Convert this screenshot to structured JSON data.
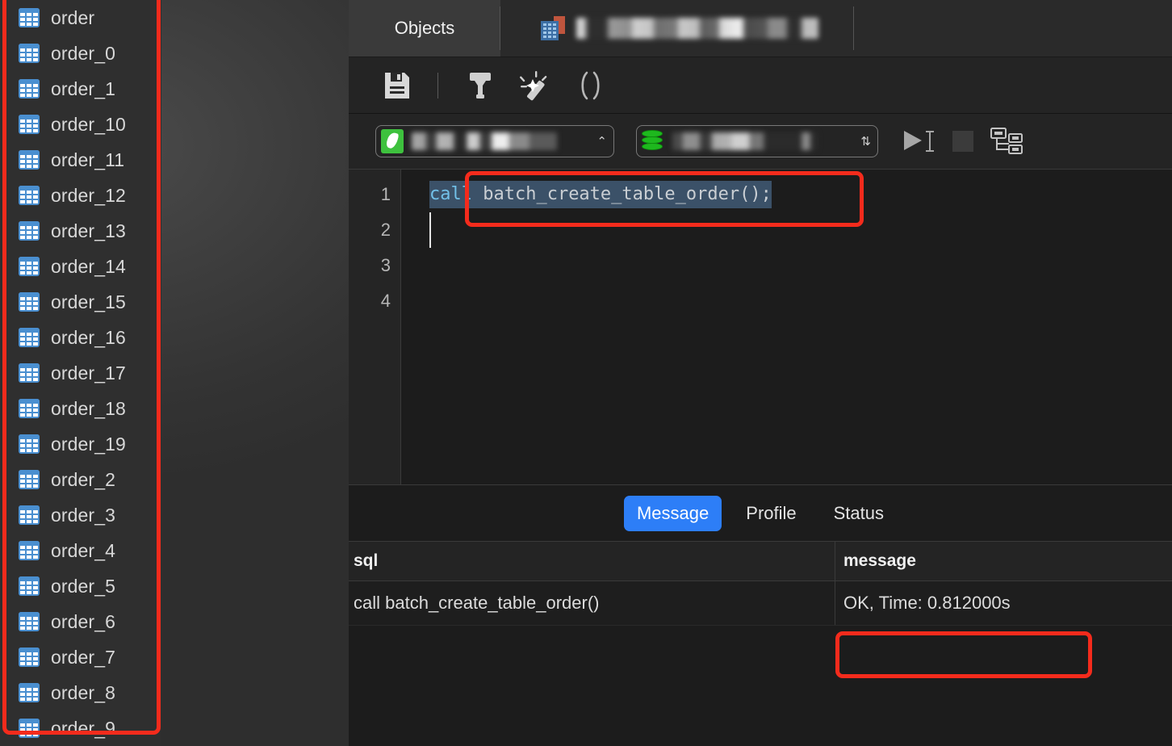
{
  "left_panel": {
    "objects": [
      {
        "label": "order",
        "icon": "table-icon"
      },
      {
        "label": "order_0",
        "icon": "table-icon"
      },
      {
        "label": "order_1",
        "icon": "table-icon"
      },
      {
        "label": "order_10",
        "icon": "table-icon"
      },
      {
        "label": "order_11",
        "icon": "table-icon"
      },
      {
        "label": "order_12",
        "icon": "table-icon"
      },
      {
        "label": "order_13",
        "icon": "table-icon"
      },
      {
        "label": "order_14",
        "icon": "table-icon"
      },
      {
        "label": "order_15",
        "icon": "table-icon"
      },
      {
        "label": "order_16",
        "icon": "table-icon"
      },
      {
        "label": "order_17",
        "icon": "table-icon"
      },
      {
        "label": "order_18",
        "icon": "table-icon"
      },
      {
        "label": "order_19",
        "icon": "table-icon"
      },
      {
        "label": "order_2",
        "icon": "table-icon"
      },
      {
        "label": "order_3",
        "icon": "table-icon"
      },
      {
        "label": "order_4",
        "icon": "table-icon"
      },
      {
        "label": "order_5",
        "icon": "table-icon"
      },
      {
        "label": "order_6",
        "icon": "table-icon"
      },
      {
        "label": "order_7",
        "icon": "table-icon"
      },
      {
        "label": "order_8",
        "icon": "table-icon"
      },
      {
        "label": "order_9",
        "icon": "table-icon"
      }
    ]
  },
  "tabs": {
    "objects_label": "Objects",
    "query_tab_label": "",
    "query_tab_icon": "query-console-icon"
  },
  "toolbar": {
    "buttons": [
      {
        "name": "save-icon",
        "glyph": "save"
      },
      {
        "name": "hammer-icon",
        "glyph": "hammer"
      },
      {
        "name": "magic-wand-icon",
        "glyph": "wand"
      },
      {
        "name": "parentheses-icon",
        "glyph": "()"
      }
    ]
  },
  "connection_bar": {
    "connection": {
      "value": "",
      "icon": "mysql-dolphin-icon",
      "caret": "⌃"
    },
    "database": {
      "value": "",
      "icon": "database-icon",
      "caret": "⇅"
    },
    "run_icon": "run-play-icon",
    "stop_icon": "stop-square-icon",
    "plan_icon": "explain-plan-icon"
  },
  "editor": {
    "line_numbers": [
      "1",
      "2",
      "3",
      "4"
    ],
    "code": {
      "keyword": "call",
      "statement": " batch_create_table_order();"
    }
  },
  "results": {
    "tabs": [
      {
        "label": "Message",
        "active": true
      },
      {
        "label": "Profile",
        "active": false
      },
      {
        "label": "Status",
        "active": false
      }
    ],
    "columns": [
      "sql",
      "message"
    ],
    "rows": [
      {
        "sql": "call batch_create_table_order()",
        "message": "OK, Time: 0.812000s"
      }
    ]
  },
  "annotations": {
    "highlight_color": "#f42b1c",
    "boxes": [
      "object-list-highlight",
      "sql-statement-highlight",
      "message-result-highlight"
    ]
  }
}
